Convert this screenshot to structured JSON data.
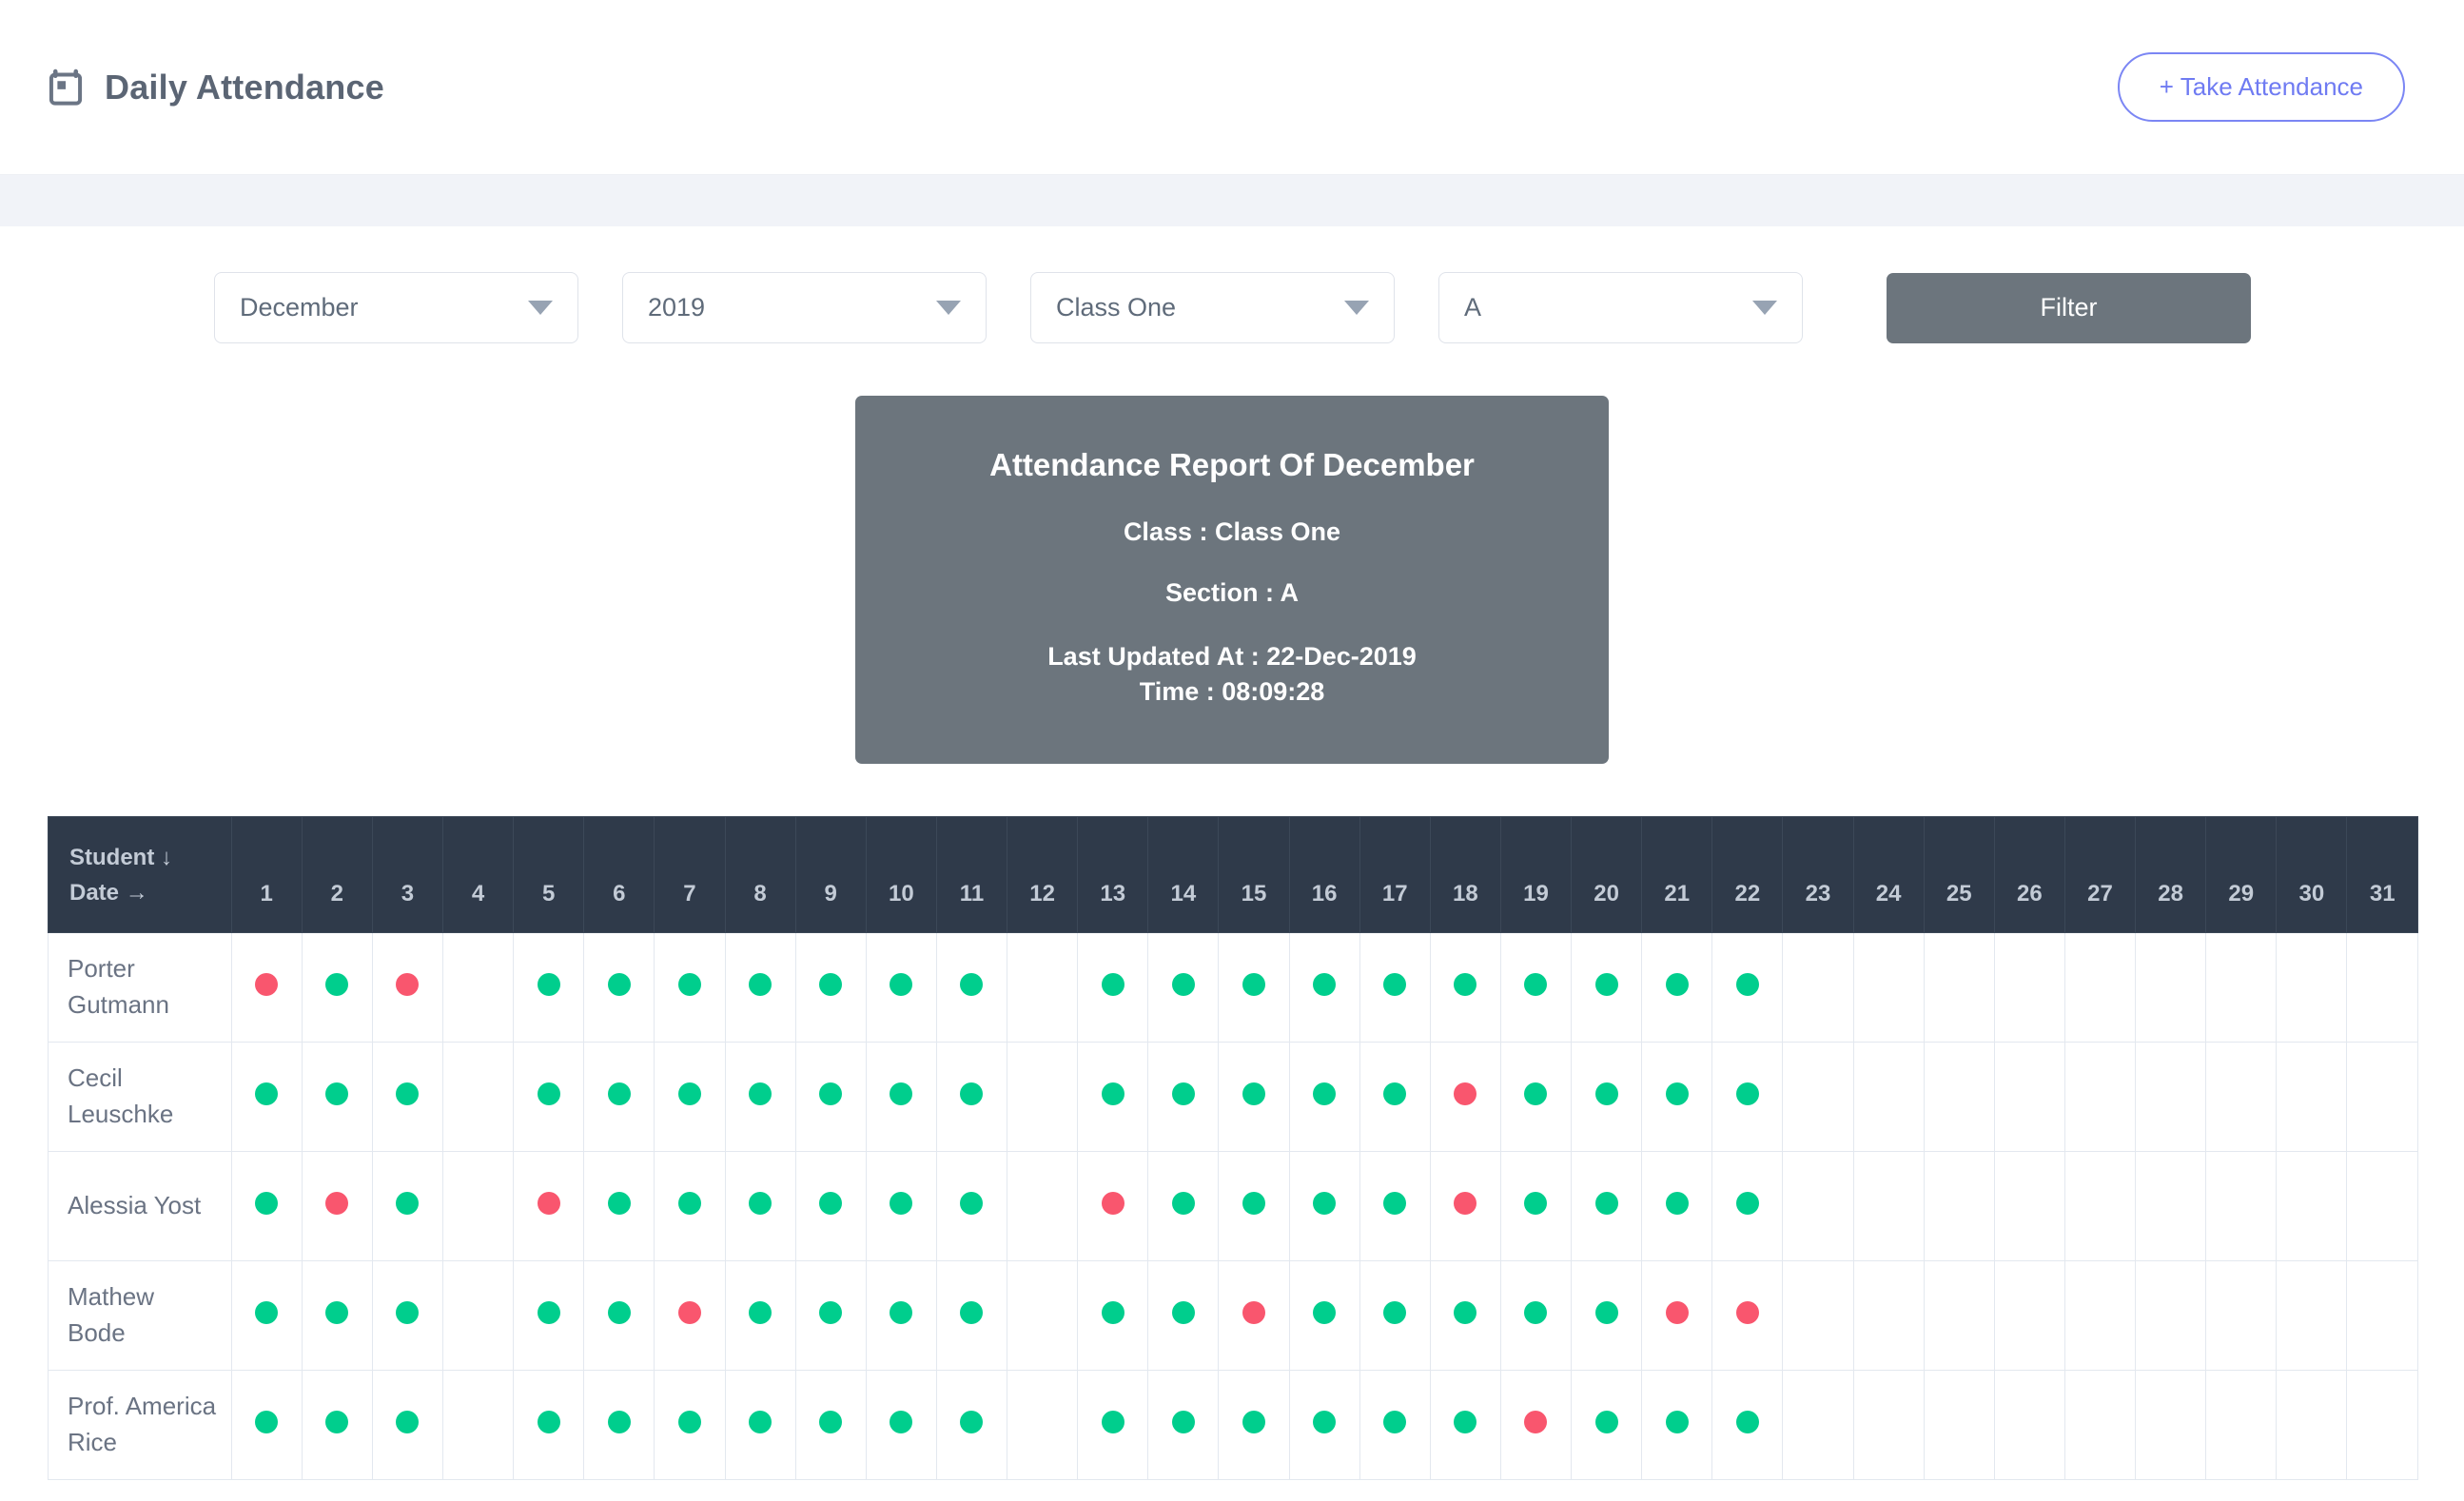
{
  "header": {
    "title": "Daily Attendance",
    "icon": "calendar-icon",
    "take_attendance_label": "+ Take Attendance"
  },
  "filters": {
    "month": "December",
    "year": "2019",
    "class": "Class One",
    "section": "A",
    "filter_label": "Filter",
    "caret_icon": "chevron-down-icon"
  },
  "report": {
    "title": "Attendance Report Of December",
    "class_line": "Class : Class One",
    "section_line": "Section : A",
    "updated_line": "Last Updated At : 22-Dec-2019",
    "time_line": "Time : 08:09:28"
  },
  "table": {
    "student_header": "Student ↓",
    "date_header": "Date →",
    "days": [
      1,
      2,
      3,
      4,
      5,
      6,
      7,
      8,
      9,
      10,
      11,
      12,
      13,
      14,
      15,
      16,
      17,
      18,
      19,
      20,
      21,
      22,
      23,
      24,
      25,
      26,
      27,
      28,
      29,
      30,
      31
    ],
    "colors": {
      "present": "#00ce8d",
      "absent": "#f9566e",
      "header_bg": "#2f3a4a"
    },
    "rows": [
      {
        "student": "Porter Gutmann",
        "marks": [
          "A",
          "P",
          "A",
          "",
          "P",
          "P",
          "P",
          "P",
          "P",
          "P",
          "P",
          "",
          "P",
          "P",
          "P",
          "P",
          "P",
          "P",
          "P",
          "P",
          "P",
          "P",
          "",
          "",
          "",
          "",
          "",
          "",
          "",
          "",
          ""
        ]
      },
      {
        "student": "Cecil Leuschke",
        "marks": [
          "P",
          "P",
          "P",
          "",
          "P",
          "P",
          "P",
          "P",
          "P",
          "P",
          "P",
          "",
          "P",
          "P",
          "P",
          "P",
          "P",
          "A",
          "P",
          "P",
          "P",
          "P",
          "",
          "",
          "",
          "",
          "",
          "",
          "",
          "",
          ""
        ]
      },
      {
        "student": "Alessia Yost",
        "marks": [
          "P",
          "A",
          "P",
          "",
          "A",
          "P",
          "P",
          "P",
          "P",
          "P",
          "P",
          "",
          "A",
          "P",
          "P",
          "P",
          "P",
          "A",
          "P",
          "P",
          "P",
          "P",
          "",
          "",
          "",
          "",
          "",
          "",
          "",
          "",
          ""
        ]
      },
      {
        "student": "Mathew Bode",
        "marks": [
          "P",
          "P",
          "P",
          "",
          "P",
          "P",
          "A",
          "P",
          "P",
          "P",
          "P",
          "",
          "P",
          "P",
          "A",
          "P",
          "P",
          "P",
          "P",
          "P",
          "A",
          "A",
          "",
          "",
          "",
          "",
          "",
          "",
          "",
          "",
          ""
        ]
      },
      {
        "student": "Prof. America Rice",
        "marks": [
          "P",
          "P",
          "P",
          "",
          "P",
          "P",
          "P",
          "P",
          "P",
          "P",
          "P",
          "",
          "P",
          "P",
          "P",
          "P",
          "P",
          "P",
          "A",
          "P",
          "P",
          "P",
          "",
          "",
          "",
          "",
          "",
          "",
          "",
          "",
          ""
        ]
      }
    ]
  }
}
